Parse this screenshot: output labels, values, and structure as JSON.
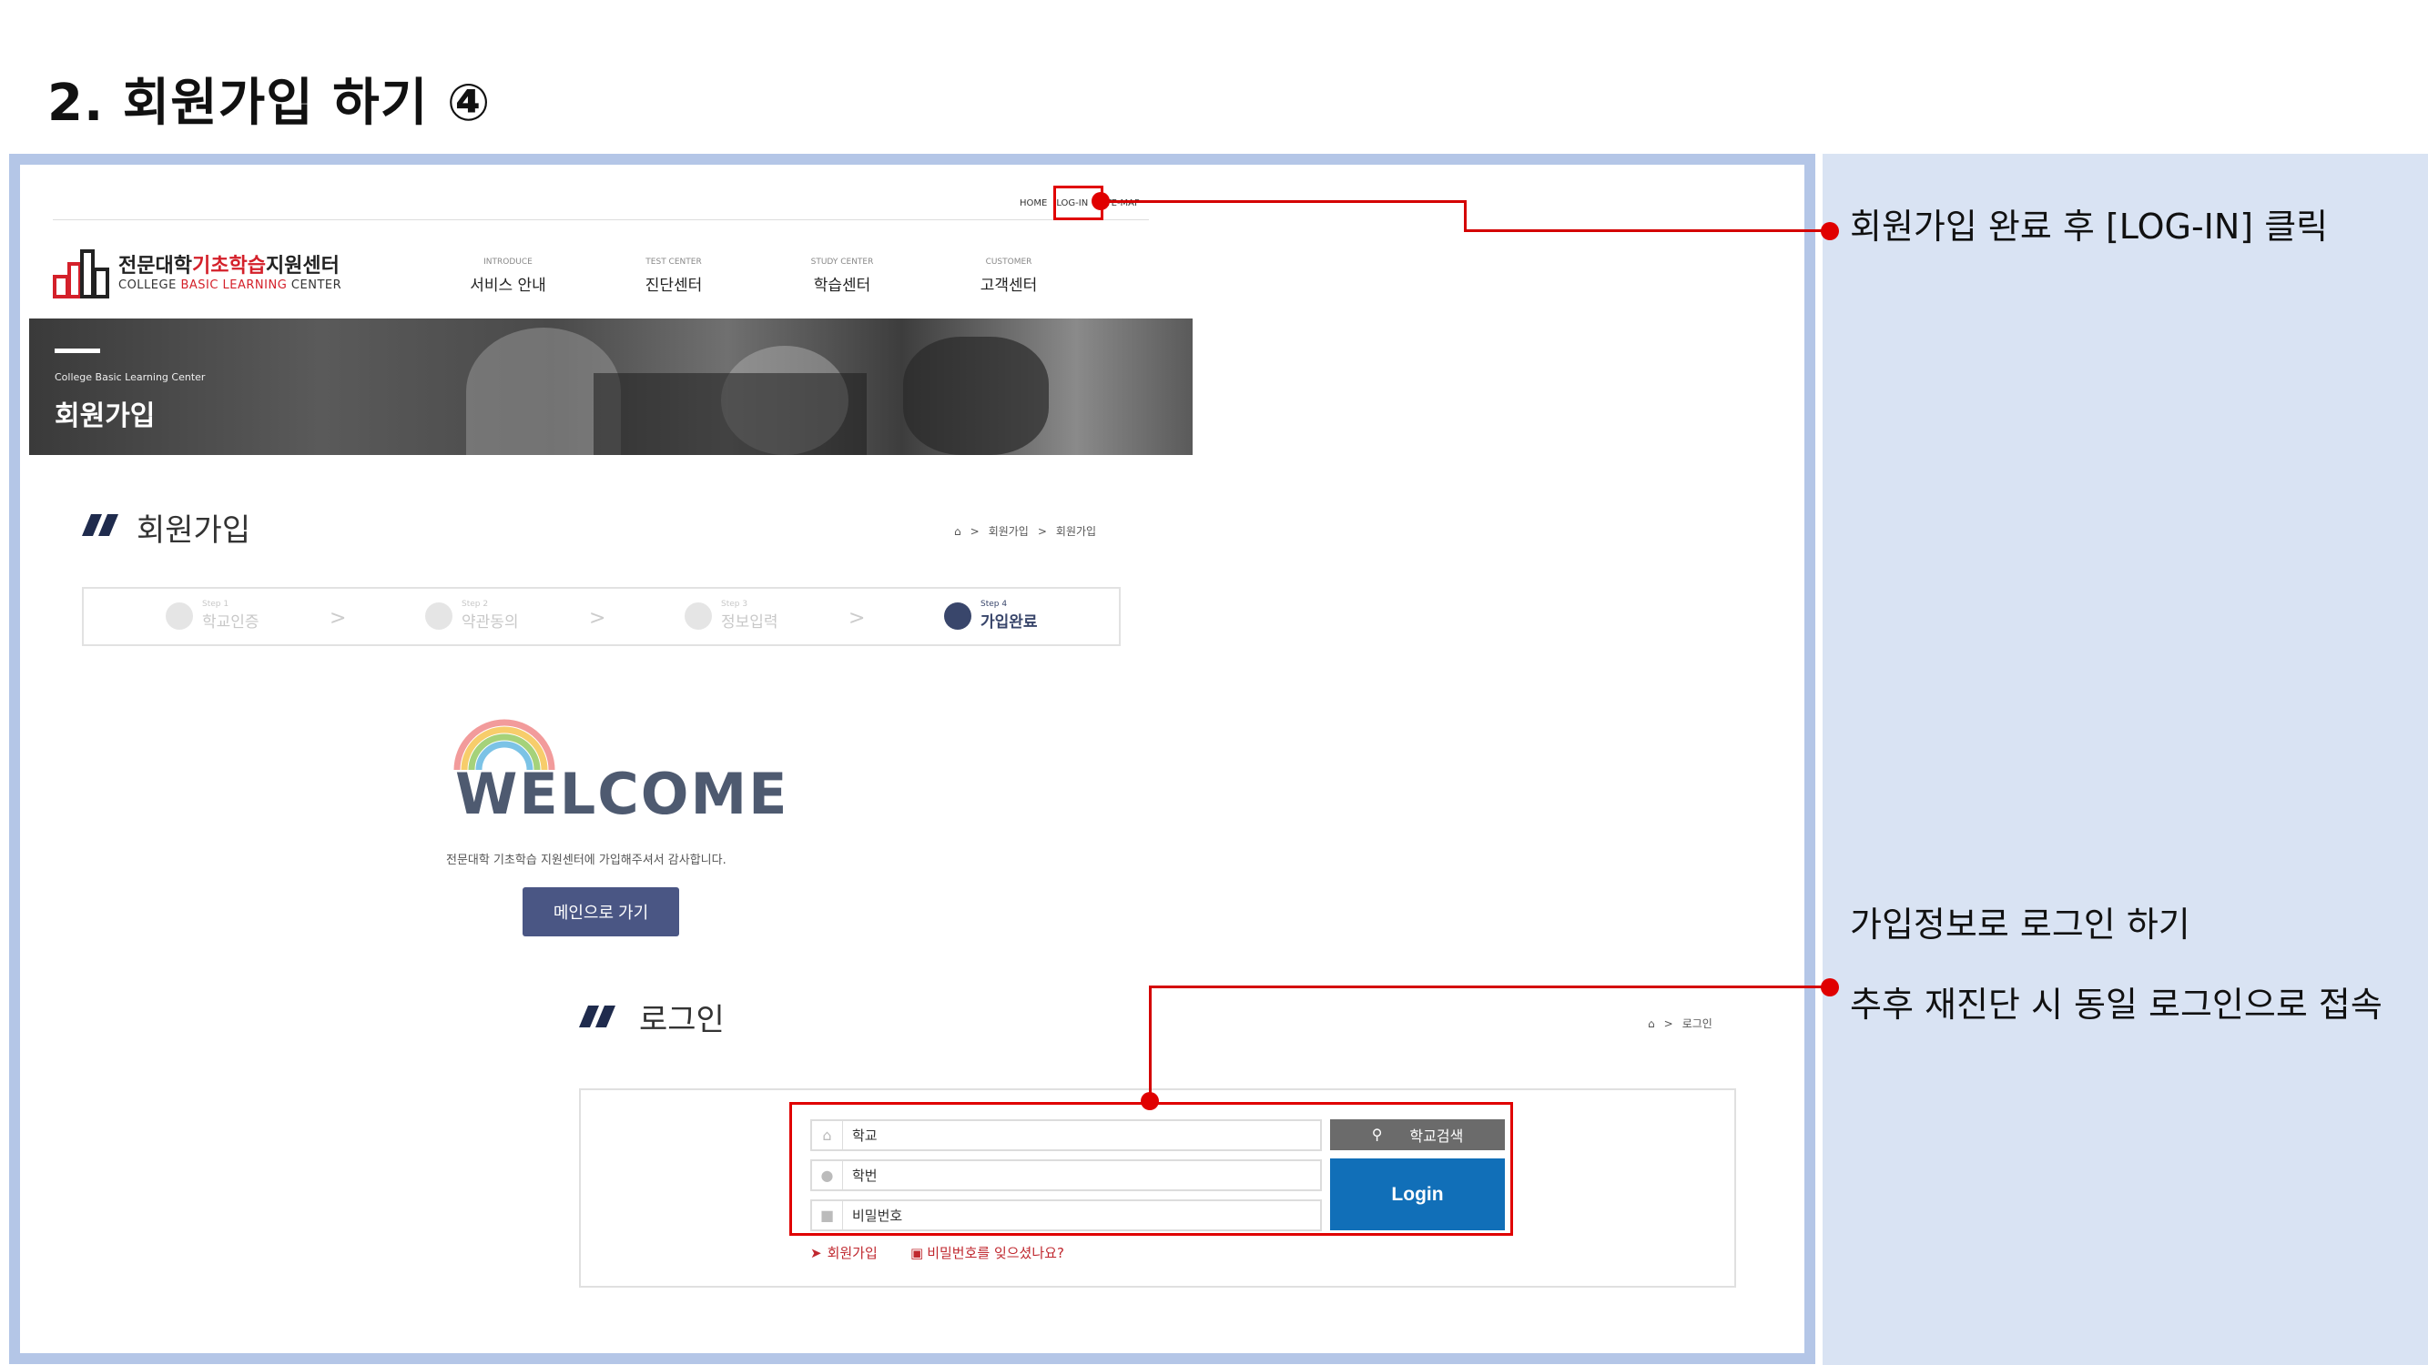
{
  "slide": {
    "title": "2. 회원가입 하기 ④",
    "notes": {
      "login_click": "회원가입 완료 후 [LOG-IN] 클릭",
      "login_with_info": "가입정보로 로그인 하기",
      "reconnect": "추후 재진단 시 동일 로그인으로 접속"
    }
  },
  "site": {
    "top_links": [
      "HOME",
      "LOG-IN",
      "SITE-MAP"
    ],
    "logo": {
      "ko_prefix": "전문대학",
      "ko_highlight": "기초학습",
      "ko_suffix": "지원센터",
      "en_prefix": "COLLEGE ",
      "en_highlight": "BASIC LEARNING",
      "en_suffix": " CENTER"
    },
    "gnb": [
      {
        "en": "INTRODUCE",
        "ko": "서비스 안내"
      },
      {
        "en": "TEST CENTER",
        "ko": "진단센터"
      },
      {
        "en": "STUDY CENTER",
        "ko": "학습센터"
      },
      {
        "en": "CUSTOMER",
        "ko": "고객센터"
      }
    ],
    "banner": {
      "subtitle": "College Basic Learning Center",
      "title": "회원가입"
    }
  },
  "signup": {
    "title": "회원가입",
    "breadcrumb": [
      "회원가입",
      "회원가입"
    ],
    "steps": [
      {
        "small": "Step 1",
        "label": "학교인증"
      },
      {
        "small": "Step 2",
        "label": "약관동의"
      },
      {
        "small": "Step 3",
        "label": "정보입력"
      },
      {
        "small": "Step 4",
        "label": "가입완료"
      }
    ],
    "active_step": 4,
    "welcome_word": "WELCOME",
    "welcome_message": "전문대학 기초학습 지원센터에 가입해주셔서 감사합니다.",
    "main_button": "메인으로 가기"
  },
  "login": {
    "title": "로그인",
    "breadcrumb": [
      "로그인"
    ],
    "fields": {
      "school": "학교",
      "student_id": "학번",
      "password": "비밀번호"
    },
    "school_search_button": "학교검색",
    "login_button": "Login",
    "join_link": "회원가입",
    "forgot_link": "비밀번호를 잊으셨나요?"
  },
  "colors": {
    "frame_border": "#b4c6e7",
    "notes_bg": "#d9e3f3",
    "annotation_red": "#e00000",
    "brand_red": "#d4202a",
    "step_active": "#39466b",
    "login_blue": "#116fb8",
    "main_button": "#4a5684"
  }
}
